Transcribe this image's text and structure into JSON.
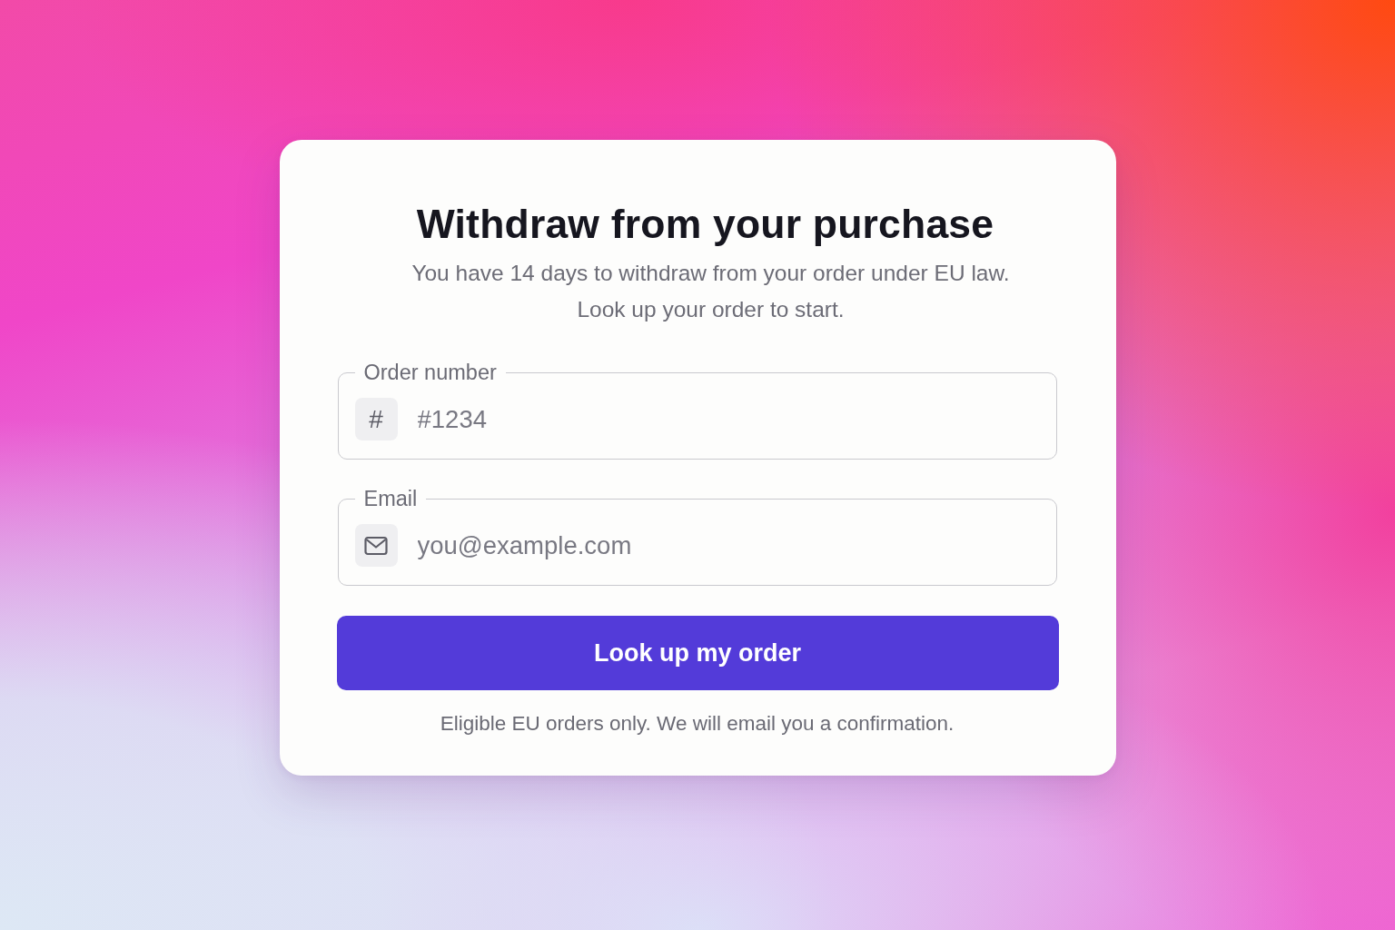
{
  "card": {
    "title": "Withdraw from your purchase",
    "subtitle": "You have 14 days to withdraw from your order under EU law. Look up your order to start."
  },
  "fields": [
    {
      "kind": "number",
      "label": "Order number",
      "prefix": "#",
      "placeholder": "#1234"
    },
    {
      "kind": "email",
      "label": "Email",
      "placeholder": "you@example.com"
    }
  ],
  "submit_button": {
    "label": "Look up my order"
  },
  "footnote": "Eligible EU orders only. We will email you a confirmation."
}
